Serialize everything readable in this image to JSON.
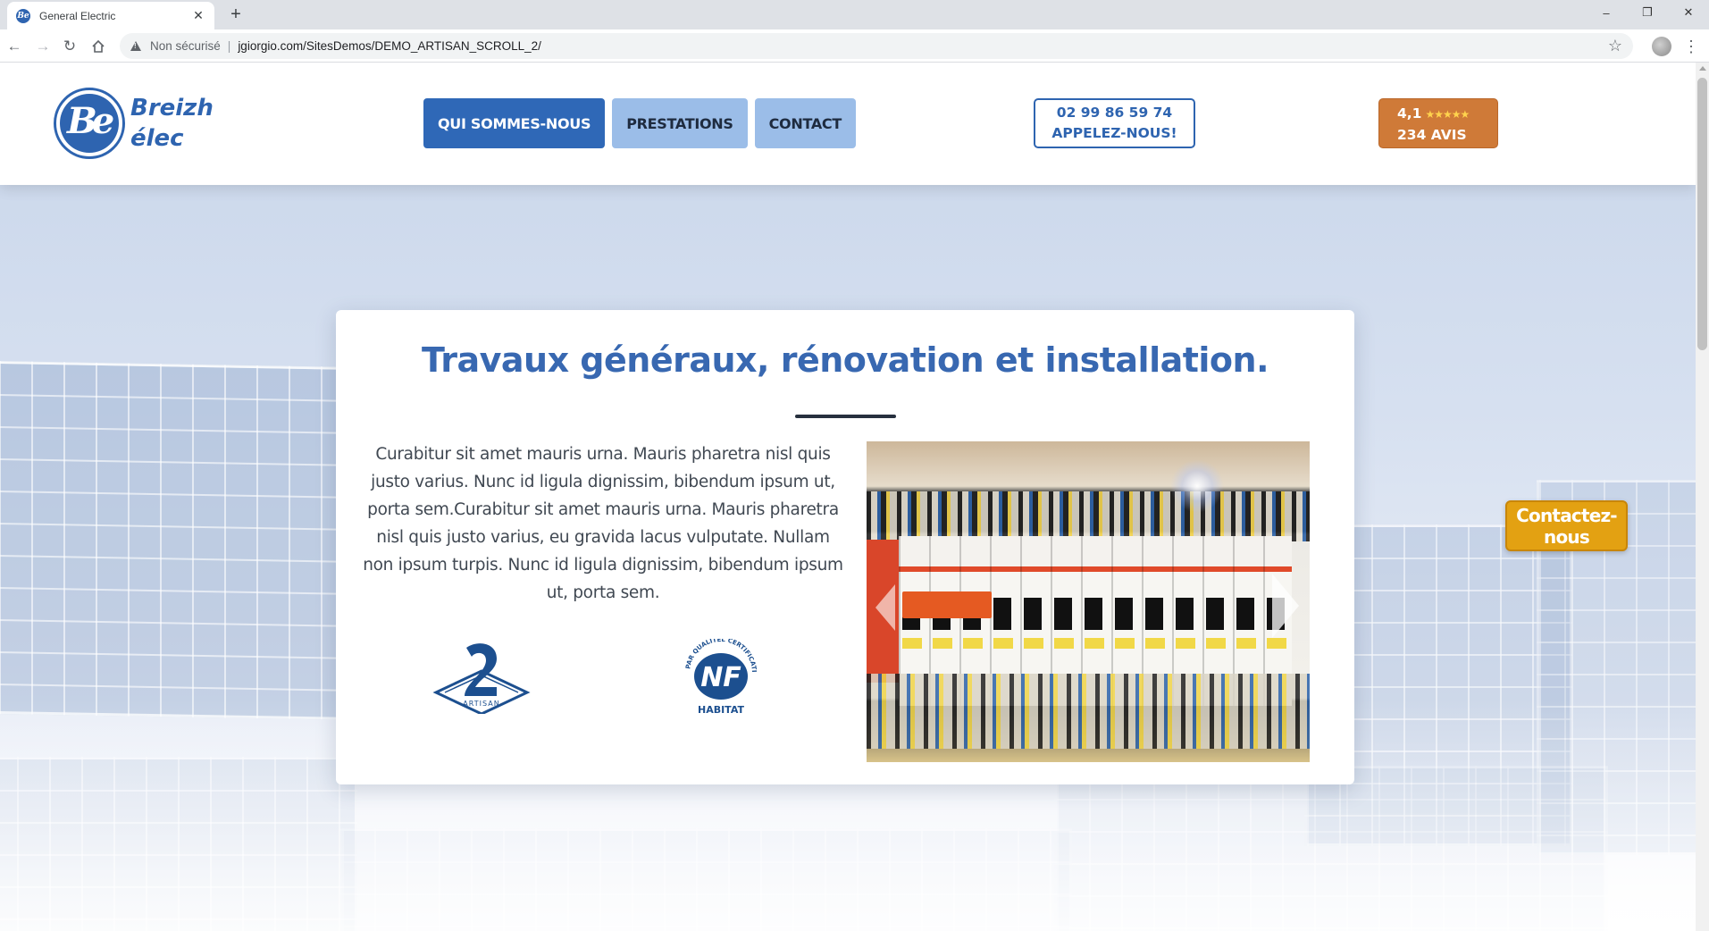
{
  "browser": {
    "tab_title": "General Electric",
    "tab_close": "✕",
    "new_tab": "+",
    "security_label": "Non sécurisé",
    "separator": "|",
    "url": "jgiorgio.com/SitesDemos/DEMO_ARTISAN_SCROLL_2/",
    "window_controls": [
      "–",
      "❐",
      "✕"
    ]
  },
  "header": {
    "logo_monogram": "Be",
    "logo_line1": "Breizh",
    "logo_line2": "élec",
    "nav": [
      "QUI SOMMES-NOUS",
      "PRESTATIONS",
      "CONTACT"
    ],
    "active_nav_index": 0,
    "phone_number": "02 99 86 59 74",
    "phone_cta": "APPELEZ-NOUS!",
    "rating_value": "4,1",
    "rating_stars": 4.5,
    "rating_count": "234 AVIS"
  },
  "card": {
    "title": "Travaux généraux, rénovation et installation.",
    "body": "Curabitur sit amet mauris urna. Mauris pharetra nisl quis justo varius. Nunc id ligula dignissim, bibendum ipsum ut, porta sem.Curabitur sit amet mauris urna. Mauris pharetra nisl quis justo varius, eu gravida lacus vulputate. Nullam non ipsum turpis. Nunc id ligula dignissim, bibendum ipsum ut, porta sem.",
    "badge_artisan": "ARTISAN",
    "badge_nf_main": "NF",
    "badge_nf_sub": "HABITAT",
    "badge_nf_ring": "PAR QUALITEL CERTIFICATION"
  },
  "floating_button": "Contactez-nous",
  "colors": {
    "brand_blue": "#2e64b0",
    "nav_light": "#9bbde8",
    "rating_orange": "#cf7a38",
    "contact_gold": "#e3a112"
  }
}
